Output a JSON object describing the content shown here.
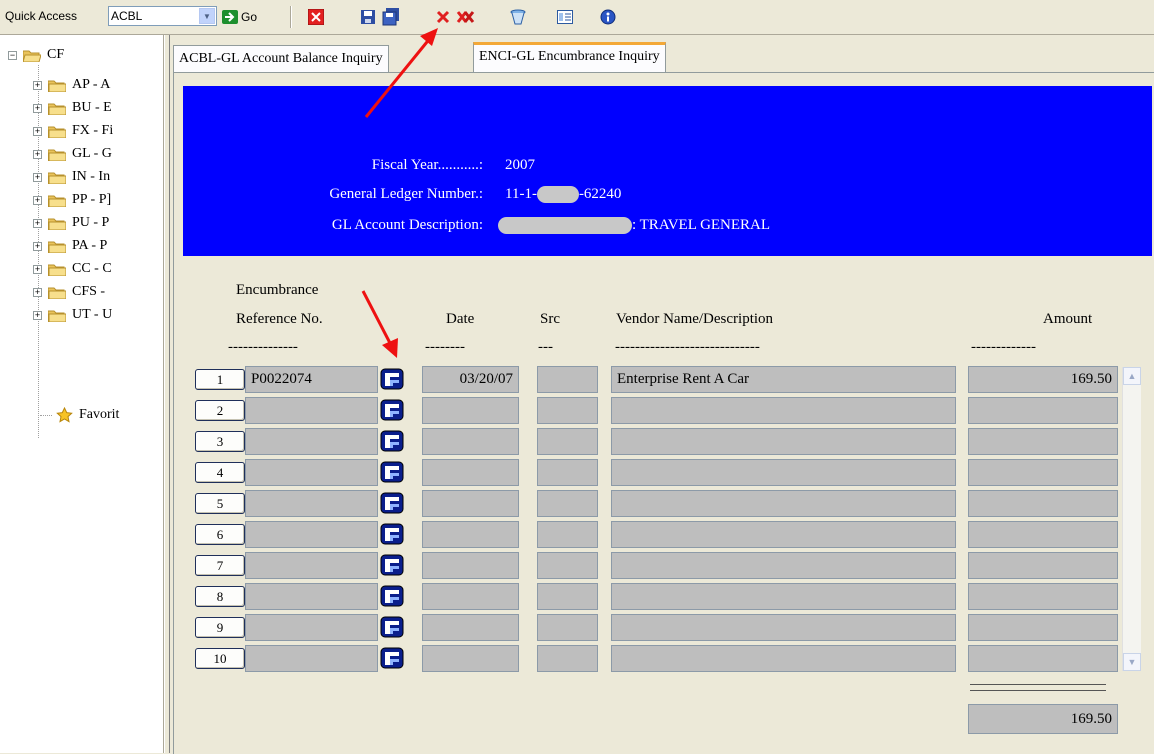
{
  "toolbar": {
    "quick_access_label": "Quick Access",
    "quick_access_value": "ACBL",
    "go_label": "Go",
    "icons": [
      "close-red-icon",
      "save-icon",
      "save-all-icon",
      "delete-icon",
      "delete-all-icon",
      "clear-icon",
      "list-view-icon",
      "help-icon"
    ]
  },
  "tree": {
    "root": "CF",
    "items": [
      {
        "label": "AP - A"
      },
      {
        "label": "BU - E"
      },
      {
        "label": "FX - Fi"
      },
      {
        "label": "GL - G"
      },
      {
        "label": "IN - In"
      },
      {
        "label": "PP - P]"
      },
      {
        "label": "PU - P"
      },
      {
        "label": "PA - P"
      },
      {
        "label": "CC - C"
      },
      {
        "label": "CFS - "
      },
      {
        "label": "UT - U"
      }
    ],
    "favorites": "Favorit"
  },
  "tabs": [
    {
      "label": "ACBL-GL Account Balance Inquiry"
    },
    {
      "label": "ENCI-GL Encumbrance Inquiry"
    }
  ],
  "header": {
    "fiscal_year_label": "Fiscal Year...........:",
    "fiscal_year": "2007",
    "gl_number_label": "General Ledger Number.:",
    "gl_number_prefix": "11-1-",
    "gl_number_suffix": "-62240",
    "description_label": "GL Account Description:",
    "description_suffix": ": TRAVEL GENERAL"
  },
  "table": {
    "headers": {
      "ref_line1": "Encumbrance",
      "ref_line2": "Reference No.",
      "date": "Date",
      "src": "Src",
      "vendor": "Vendor Name/Description",
      "amount": "Amount"
    },
    "dashes": {
      "ref": "--------------",
      "date": "--------",
      "src": "---",
      "vendor": "-----------------------------",
      "amount": "-------------"
    },
    "rows": [
      {
        "num": "1",
        "ref": "P0022074",
        "date": "03/20/07",
        "src": "",
        "vendor": "Enterprise Rent A Car",
        "amount": "169.50"
      },
      {
        "num": "2",
        "ref": "",
        "date": "",
        "src": "",
        "vendor": "",
        "amount": ""
      },
      {
        "num": "3",
        "ref": "",
        "date": "",
        "src": "",
        "vendor": "",
        "amount": ""
      },
      {
        "num": "4",
        "ref": "",
        "date": "",
        "src": "",
        "vendor": "",
        "amount": ""
      },
      {
        "num": "5",
        "ref": "",
        "date": "",
        "src": "",
        "vendor": "",
        "amount": ""
      },
      {
        "num": "6",
        "ref": "",
        "date": "",
        "src": "",
        "vendor": "",
        "amount": ""
      },
      {
        "num": "7",
        "ref": "",
        "date": "",
        "src": "",
        "vendor": "",
        "amount": ""
      },
      {
        "num": "8",
        "ref": "",
        "date": "",
        "src": "",
        "vendor": "",
        "amount": ""
      },
      {
        "num": "9",
        "ref": "",
        "date": "",
        "src": "",
        "vendor": "",
        "amount": ""
      },
      {
        "num": "10",
        "ref": "",
        "date": "",
        "src": "",
        "vendor": "",
        "amount": ""
      }
    ],
    "total": "169.50"
  },
  "colors": {
    "header_bg": "#0000ff",
    "cell_bg": "#bebebe",
    "annotation_arrow": "#ee1111",
    "tab_highlight": "#f3a837"
  }
}
